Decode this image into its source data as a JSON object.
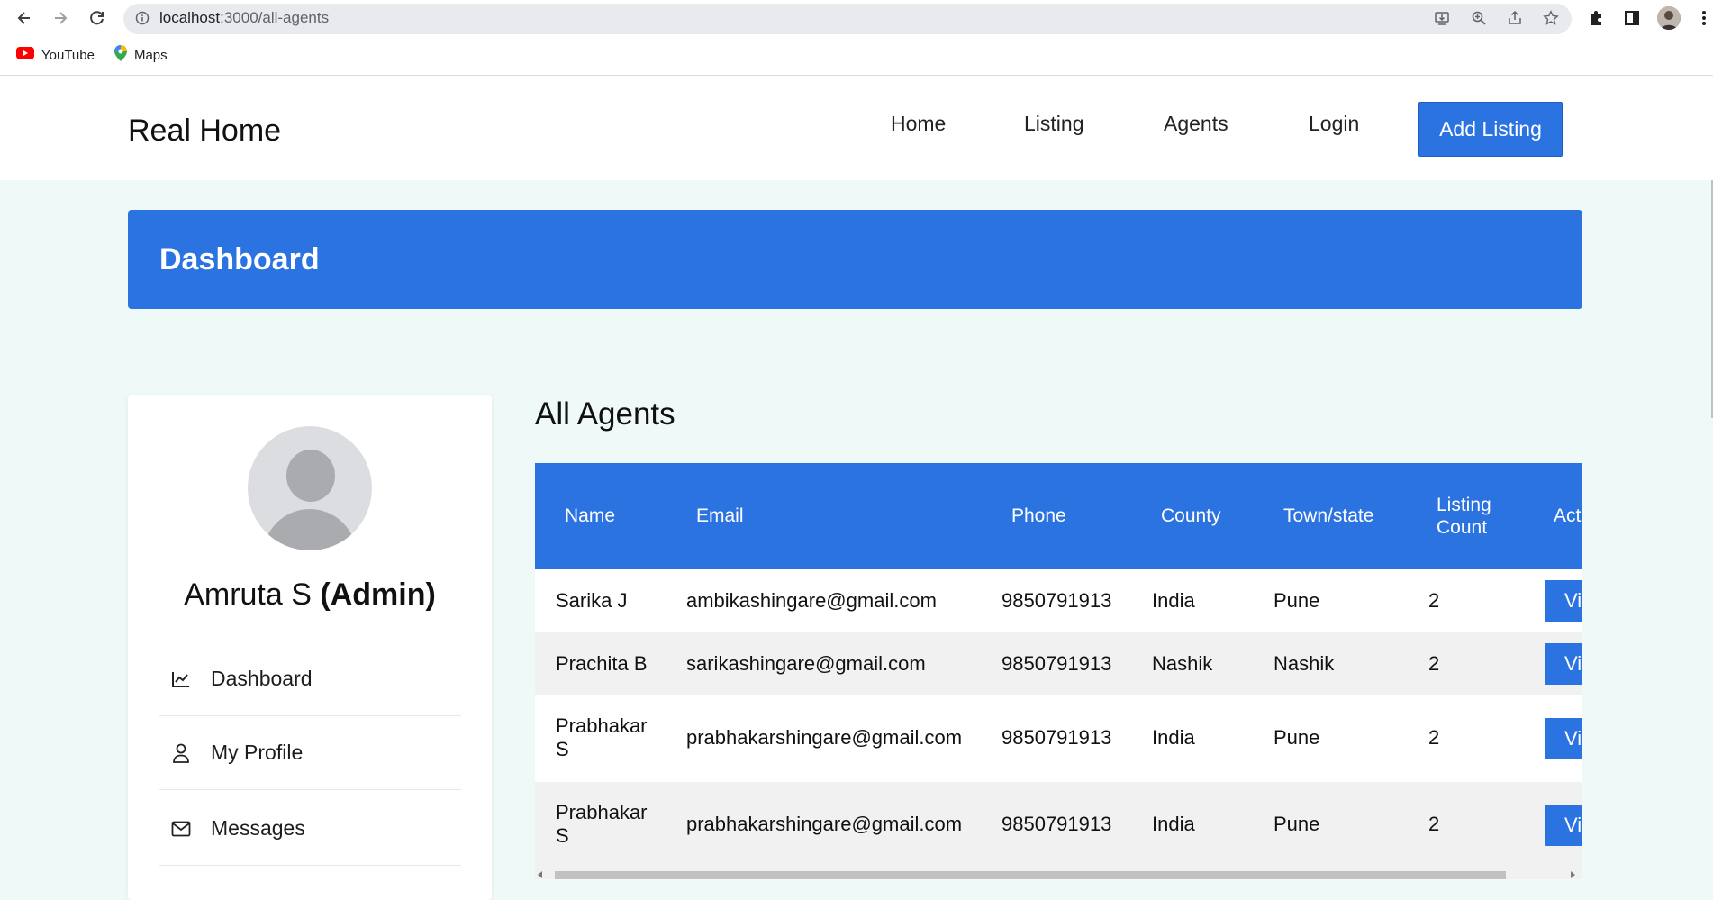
{
  "browser": {
    "url_host": "localhost",
    "url_path": ":3000/all-agents",
    "bookmarks": [
      {
        "label": "YouTube",
        "icon": "youtube-icon"
      },
      {
        "label": "Maps",
        "icon": "maps-pin-icon"
      }
    ]
  },
  "header": {
    "brand": "Real Home",
    "nav": [
      "Home",
      "Listing",
      "Agents",
      "Login"
    ],
    "cta": "Add Listing"
  },
  "banner": {
    "title": "Dashboard"
  },
  "profile": {
    "name": "Amruta S",
    "role": "(Admin)",
    "menu": [
      {
        "label": "Dashboard",
        "icon": "chart-line-icon"
      },
      {
        "label": "My Profile",
        "icon": "user-icon"
      },
      {
        "label": "Messages",
        "icon": "envelope-icon"
      }
    ]
  },
  "agents": {
    "title": "All Agents",
    "columns": [
      "Name",
      "Email",
      "Phone",
      "County",
      "Town/state",
      "Listing Count",
      "Act"
    ],
    "rows": [
      {
        "name": "Sarika J",
        "email": "ambikashingare@gmail.com",
        "phone": "9850791913",
        "county": "India",
        "town": "Pune",
        "count": "2",
        "action": "Vi"
      },
      {
        "name": "Prachita B",
        "email": "sarikashingare@gmail.com",
        "phone": "9850791913",
        "county": "Nashik",
        "town": "Nashik",
        "count": "2",
        "action": "Vi"
      },
      {
        "name": "Prabhakar S",
        "email": "prabhakarshingare@gmail.com",
        "phone": "9850791913",
        "county": "India",
        "town": "Pune",
        "count": "2",
        "action": "Vi"
      },
      {
        "name": "Prabhakar S",
        "email": "prabhakarshingare@gmail.com",
        "phone": "9850791913",
        "county": "India",
        "town": "Pune",
        "count": "2",
        "action": "Vi"
      }
    ]
  },
  "colors": {
    "accent": "#2b73e0",
    "page_bg": "#eef9f8"
  }
}
